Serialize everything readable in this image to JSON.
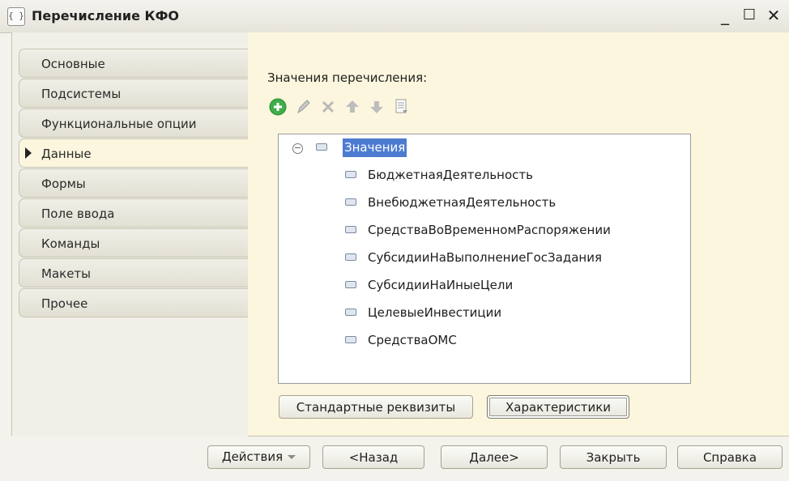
{
  "window": {
    "title": "Перечисление КФО",
    "icon": "metadata-object-icon",
    "controls": [
      "minimize-icon",
      "maximize-icon",
      "close-icon"
    ]
  },
  "sidebar": {
    "tabs": [
      {
        "label": "Основные",
        "active": false
      },
      {
        "label": "Подсистемы",
        "active": false
      },
      {
        "label": "Функциональные опции",
        "active": false
      },
      {
        "label": "Данные",
        "active": true
      },
      {
        "label": "Формы",
        "active": false
      },
      {
        "label": "Поле ввода",
        "active": false
      },
      {
        "label": "Команды",
        "active": false
      },
      {
        "label": "Макеты",
        "active": false
      },
      {
        "label": "Прочее",
        "active": false
      }
    ]
  },
  "main": {
    "enum_values_label": "Значения перечисления:",
    "toolbar": [
      "add-icon",
      "edit-icon",
      "delete-icon",
      "move-up-icon",
      "move-down-icon",
      "list-icon"
    ],
    "tree": {
      "root": "Значения",
      "items": [
        "БюджетнаяДеятельность",
        "ВнебюджетнаяДеятельность",
        "СредстваВоВременномРаспоряжении",
        "СубсидииНаВыполнениеГосЗадания",
        "СубсидииНаИныеЦели",
        "ЦелевыеИнвестиции",
        "СредстваОМС"
      ]
    },
    "buttons": {
      "standard_attributes": "Стандартные реквизиты",
      "characteristics": "Характеристики"
    }
  },
  "footer": {
    "actions": "Действия",
    "back": "<Назад",
    "next": "Далее>",
    "close": "Закрыть",
    "help": "Справка"
  },
  "colors": {
    "selection": "#4d7bd1",
    "panel": "#fbf6dd",
    "add": "#3fae49"
  }
}
